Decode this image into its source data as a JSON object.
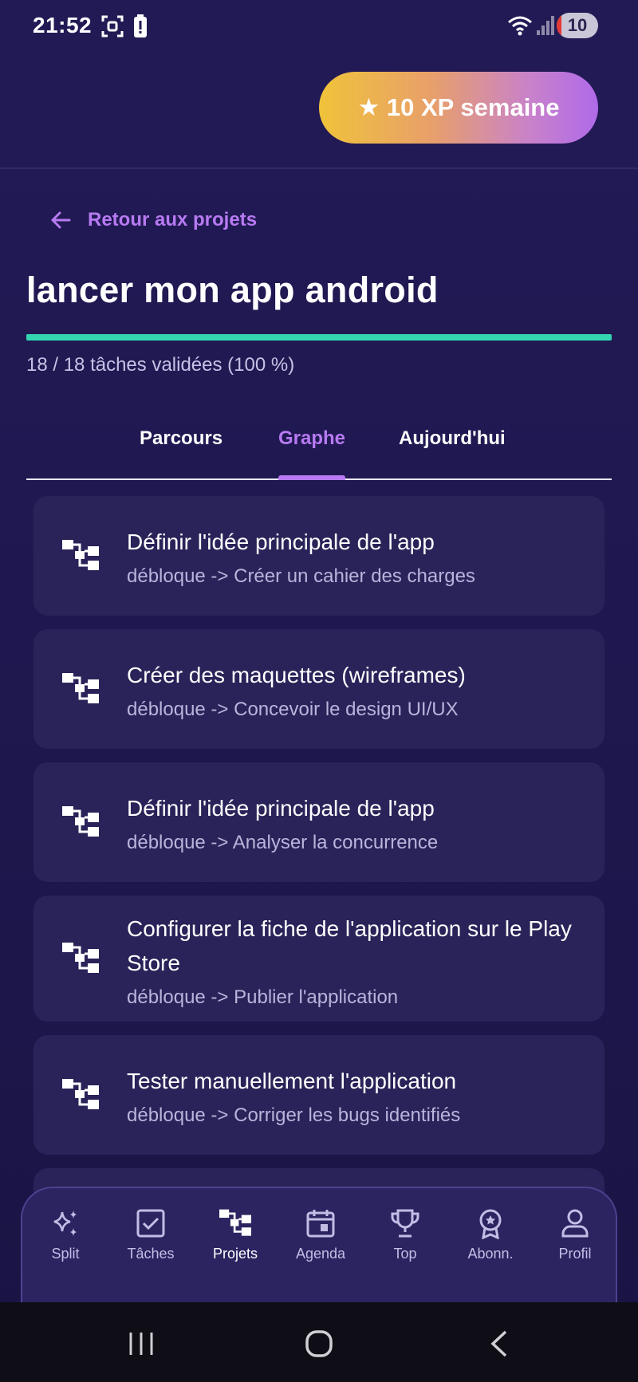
{
  "status_bar": {
    "time": "21:52",
    "battery": "10"
  },
  "header": {
    "xp_label": "★ 10 XP semaine"
  },
  "back_link": "Retour aux projets",
  "project": {
    "title": "lancer mon app android",
    "progress_percent": 100,
    "progress_text": "18 / 18 tâches validées (100 %)"
  },
  "tabs": [
    {
      "label": "Parcours",
      "active": false
    },
    {
      "label": "Graphe",
      "active": true
    },
    {
      "label": "Aujourd'hui",
      "active": false
    }
  ],
  "dependencies": [
    {
      "title": "Définir l'idée principale de l'app",
      "subtitle": "débloque -> Créer un cahier des charges"
    },
    {
      "title": "Créer des maquettes (wireframes)",
      "subtitle": "débloque -> Concevoir le design UI/UX"
    },
    {
      "title": "Définir l'idée principale de l'app",
      "subtitle": "débloque -> Analyser la concurrence"
    },
    {
      "title": "Configurer la fiche de l'application sur le Play Store",
      "subtitle": "débloque -> Publier l'application"
    },
    {
      "title": "Tester manuellement l'application",
      "subtitle": "débloque -> Corriger les bugs identifiés"
    }
  ],
  "bottom_nav": [
    {
      "label": "Split",
      "icon": "sparkles-icon",
      "active": false
    },
    {
      "label": "Tâches",
      "icon": "checkbox-icon",
      "active": false
    },
    {
      "label": "Projets",
      "icon": "hierarchy-icon",
      "active": true
    },
    {
      "label": "Agenda",
      "icon": "calendar-icon",
      "active": false
    },
    {
      "label": "Top",
      "icon": "trophy-icon",
      "active": false
    },
    {
      "label": "Abonn.",
      "icon": "badge-icon",
      "active": false
    },
    {
      "label": "Profil",
      "icon": "person-icon",
      "active": false
    }
  ],
  "colors": {
    "accent": "#b77af2",
    "progress": "#33d6b0",
    "card": "#2a2359",
    "background": "#221a55"
  }
}
